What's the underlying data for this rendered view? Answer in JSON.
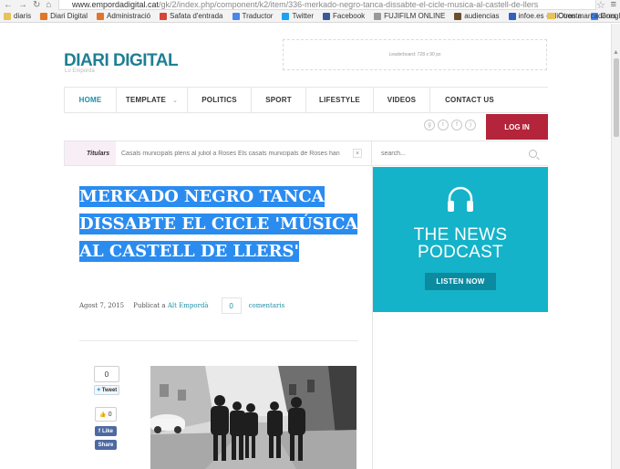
{
  "browser": {
    "url_host": "www.empordadigital.cat",
    "url_path": "/gk/2/index.php/component/k2/item/336-merkado-negro-tanca-dissabte-el-cicle-musica-al-castell-de-llers",
    "bookmarks": [
      {
        "label": "diaris",
        "icon": "folder-icon",
        "color": "#e8c15a"
      },
      {
        "label": "Diari Digital",
        "icon": "joomla-icon",
        "color": "#e0762a"
      },
      {
        "label": "Administració",
        "icon": "joomla-icon",
        "color": "#e0762a"
      },
      {
        "label": "Safata d'entrada",
        "icon": "gmail-icon",
        "color": "#d44638"
      },
      {
        "label": "Traductor",
        "icon": "translate-icon",
        "color": "#4a86e8"
      },
      {
        "label": "Twitter",
        "icon": "twitter-icon",
        "color": "#1da1f2"
      },
      {
        "label": "Facebook",
        "icon": "facebook-icon",
        "color": "#3b5998"
      },
      {
        "label": "FUJIFILM ONLINE",
        "icon": "page-icon",
        "color": "#999999"
      },
      {
        "label": "audiencias",
        "icon": "chart-icon",
        "color": "#6b4e2e"
      },
      {
        "label": "infoe.es - MiCuenta",
        "icon": "infoe-icon",
        "color": "#3060c0"
      },
      {
        "label": "Google",
        "icon": "google-icon",
        "color": "#4285f4"
      }
    ],
    "other_bookmarks": "Otros marcadores"
  },
  "header": {
    "logo": "DIARI DIGITAL",
    "logo_sub": "Lo Empordà",
    "ad_text": "Leaderboard: 728 x 90 px"
  },
  "nav": {
    "items": [
      {
        "label": "HOME",
        "active": true
      },
      {
        "label": "TEMPLATE",
        "has_caret": true
      },
      {
        "label": "POLITICS"
      },
      {
        "label": "SPORT"
      },
      {
        "label": "LIFESTYLE"
      },
      {
        "label": "VIDEOS"
      },
      {
        "label": "CONTACT US"
      }
    ],
    "login": "LOG IN"
  },
  "ticker": {
    "label": "Titulars",
    "text": "Casals municipals plens al juliol a Roses  Els casals municipals de Roses han"
  },
  "search": {
    "placeholder": "search..."
  },
  "article": {
    "title": "MERKADO NEGRO TANCA DISSABTE EL CICLE 'MÚSICA AL CASTELL DE LLERS'",
    "date": "Agost 7, 2015",
    "published_prefix": "Publicat a",
    "category": "Alt Empordà",
    "comment_count": "0",
    "comments_label": "comentaris"
  },
  "share": {
    "tweet_count": "0",
    "tweet_label": "Tweet",
    "fb_count": "0",
    "fb_like": "Like",
    "fb_share": "Share"
  },
  "podcast": {
    "line1": "THE NEWS",
    "line2": "PODCAST",
    "button": "LISTEN NOW",
    "bg_color": "#14b3c9"
  },
  "colors": {
    "brand": "#1f7f93",
    "login": "#b4243a",
    "selection": "#2b8cf0"
  }
}
